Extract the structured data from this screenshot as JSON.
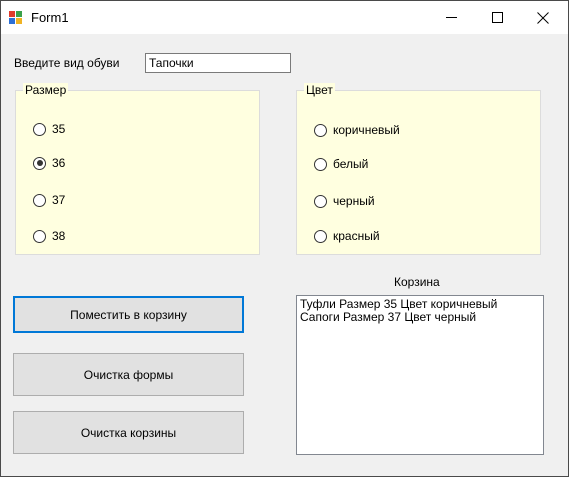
{
  "window": {
    "title": "Form1",
    "icon": "winforms-app-icon"
  },
  "form": {
    "shoe_label": "Введите вид обуви",
    "shoe_value": "Тапочки"
  },
  "size_group": {
    "legend": "Размер",
    "options": [
      {
        "label": "35",
        "checked": false
      },
      {
        "label": "36",
        "checked": true
      },
      {
        "label": "37",
        "checked": false
      },
      {
        "label": "38",
        "checked": false
      }
    ]
  },
  "color_group": {
    "legend": "Цвет",
    "options": [
      {
        "label": "коричневый",
        "checked": false
      },
      {
        "label": "белый",
        "checked": false
      },
      {
        "label": "черный",
        "checked": false
      },
      {
        "label": "красный",
        "checked": false
      }
    ]
  },
  "buttons": {
    "add_to_cart": "Поместить в корзину",
    "clear_form": "Очистка формы",
    "clear_cart": "Очистка корзины"
  },
  "cart": {
    "label": "Корзина",
    "items": [
      "Туфли Размер 35 Цвет коричневый",
      "Сапоги Размер 37 Цвет черный"
    ]
  },
  "colors": {
    "groupbox_bg": "#ffffe0",
    "focus_border": "#0078d7"
  }
}
